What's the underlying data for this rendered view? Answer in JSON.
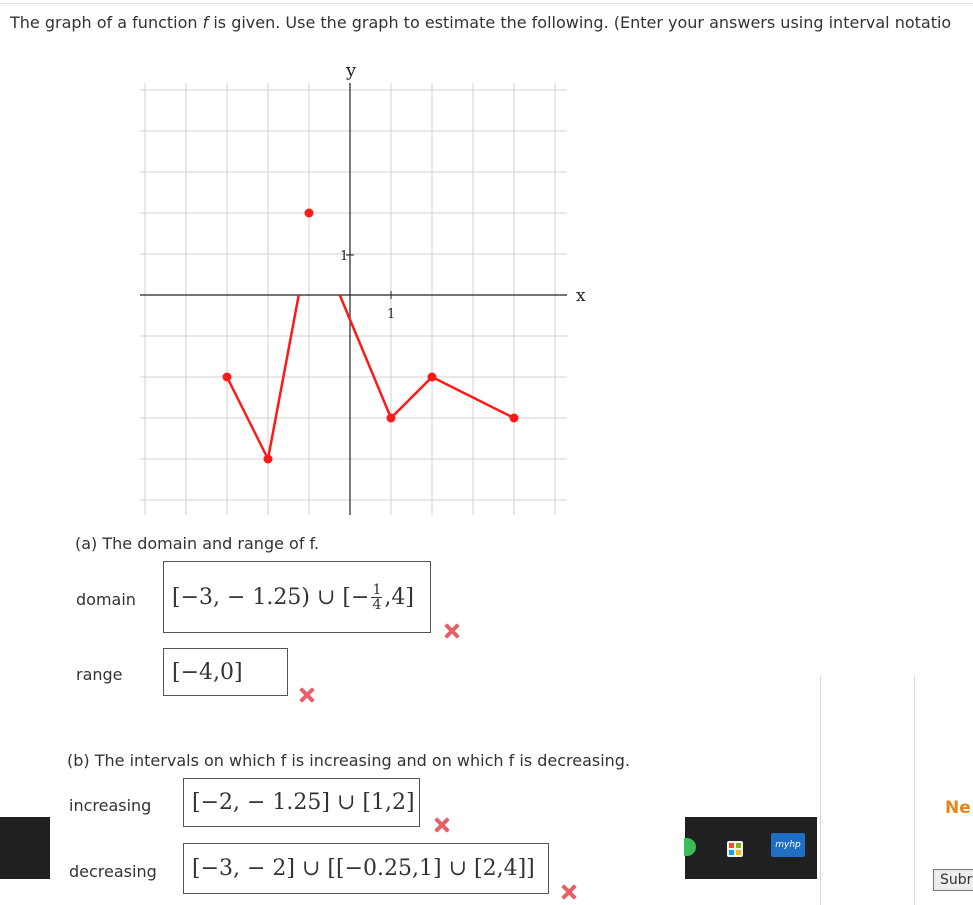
{
  "question": {
    "prompt_part1": "The graph of a function ",
    "prompt_f": "f",
    "prompt_part2": " is given. Use the graph to estimate the following. (Enter your answers using interval notatio"
  },
  "graph": {
    "y_label": "y",
    "x_label": "x",
    "tick_y": "1",
    "tick_x": "1",
    "line_color": "#ff1a1a",
    "segments": [
      [
        [
          -3,
          -2
        ],
        [
          -2,
          -4
        ]
      ],
      [
        [
          -2,
          -4
        ],
        [
          -1.25,
          0
        ]
      ],
      [
        [
          -0.25,
          0
        ],
        [
          1,
          -3
        ]
      ],
      [
        [
          1,
          -3
        ],
        [
          2,
          -2
        ]
      ],
      [
        [
          2,
          -2
        ],
        [
          4,
          -3
        ]
      ]
    ],
    "closed_points": [
      [
        -3,
        -2
      ],
      [
        -2,
        -4
      ],
      [
        -1,
        2
      ],
      [
        1,
        -3
      ],
      [
        2,
        -2
      ],
      [
        4,
        -3
      ]
    ]
  },
  "part_a": {
    "heading": "(a) The domain and range of f.",
    "domain_label": "domain",
    "domain_answer_1": "[−3, − 1.25) ∪ [−",
    "domain_frac_num": "1",
    "domain_frac_den": "4",
    "domain_answer_2": ",4]",
    "range_label": "range",
    "range_answer": "[−4,0]"
  },
  "part_b": {
    "heading": "(b) The intervals on which f is increasing and on which f is decreasing.",
    "increasing_label": "increasing",
    "increasing_answer": "[−2, − 1.25] ∪ [1,2]",
    "decreasing_label": "decreasing",
    "decreasing_answer": "[−3, − 2] ∪ [[−0.25,1] ∪ [2,4]]"
  },
  "side": {
    "need_help": "Ne",
    "submit": "Subr",
    "hp_logo": "myhp"
  },
  "colors": {
    "wrong_mark": "#e8606a",
    "accent": "#e8841a"
  }
}
